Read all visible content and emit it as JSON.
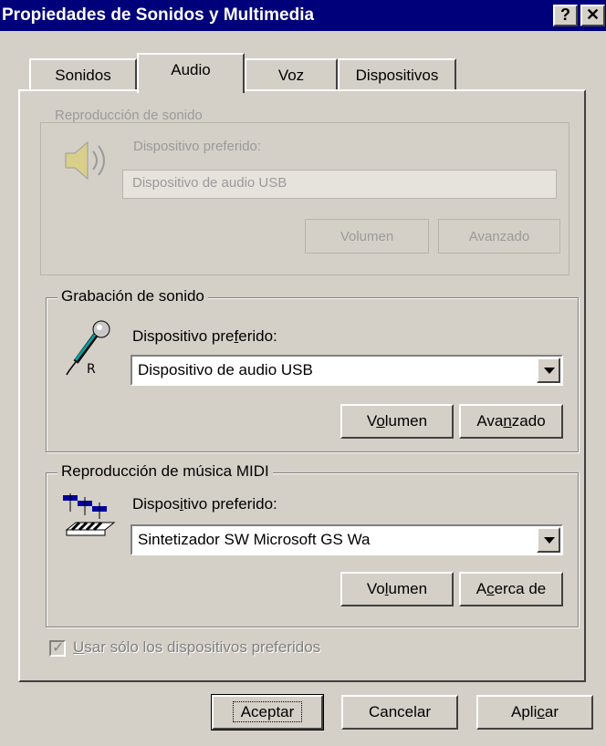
{
  "window": {
    "title": "Propiedades de Sonidos y Multimedia",
    "help_label": "?",
    "close_label": "✕"
  },
  "tabs": [
    {
      "label": "Sonidos"
    },
    {
      "label": "Audio"
    },
    {
      "label": "Voz"
    },
    {
      "label": "Dispositivos"
    }
  ],
  "ghost": {
    "section": "Reproducción de sonido",
    "preferred": "Dispositivo preferido:",
    "device": "Dispositivo de audio USB",
    "volume": "Volumen",
    "advanced": "Avanzado"
  },
  "recording": {
    "legend": "Grabación de sonido",
    "preferred_label": {
      "pre": "Dispositivo pre",
      "key": "f",
      "post": "erido:"
    },
    "device": "Dispositivo de audio USB",
    "volume": {
      "pre": "V",
      "key": "o",
      "post": "lumen"
    },
    "advanced": {
      "pre": "Ava",
      "key": "n",
      "post": "zado"
    },
    "icon": "microphone-icon"
  },
  "midi": {
    "legend": "Reproducción de música MIDI",
    "preferred_label": {
      "pre": "Dispos",
      "key": "i",
      "post": "tivo preferido:"
    },
    "device": "Sintetizador SW Microsoft GS Wa",
    "volume": {
      "pre": "Vo",
      "key": "l",
      "post": "umen"
    },
    "about": {
      "pre": "A",
      "key": "c",
      "post": "erca de"
    },
    "icon": "midi-keyboard-icon"
  },
  "preferred_only": {
    "key": "U",
    "post": "sar sólo los dispositivos preferidos",
    "checked": true,
    "disabled": true
  },
  "footer": {
    "ok": "Aceptar",
    "cancel": "Cancelar",
    "apply": {
      "pre": "Apli",
      "key": "c",
      "post": "ar"
    }
  }
}
